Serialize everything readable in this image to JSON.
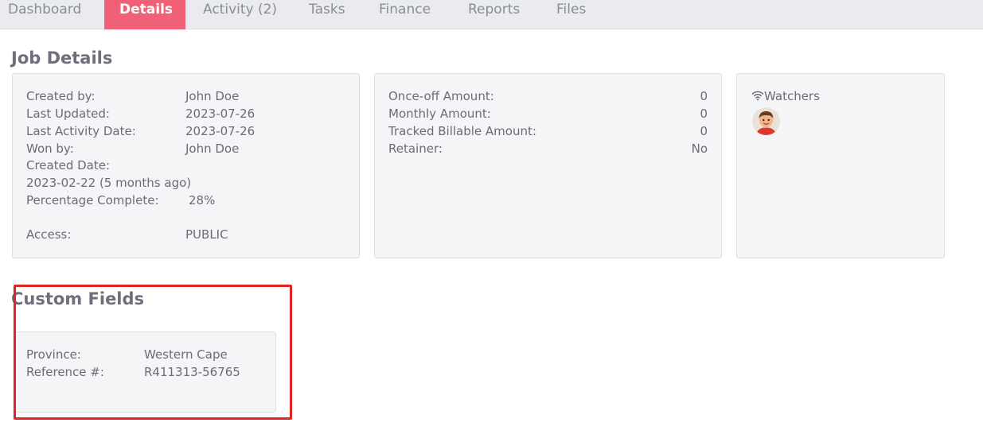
{
  "tabs": {
    "dashboard": "Dashboard",
    "details": "Details",
    "activity": "Activity (2)",
    "tasks": "Tasks",
    "finance": "Finance",
    "reports": "Reports",
    "files": "Files"
  },
  "job_details": {
    "title": "Job Details",
    "info": {
      "created_by_label": "Created by:",
      "created_by_value": "John Doe",
      "last_updated_label": "Last Updated:",
      "last_updated_value": "2023-07-26",
      "last_activity_label": "Last Activity Date:",
      "last_activity_value": "2023-07-26",
      "won_by_label": "Won by:",
      "won_by_value": "John Doe",
      "created_date_label": "Created Date:",
      "created_date_value": "2023-02-22 (5 months ago)",
      "percentage_label": "Percentage Complete:",
      "percentage_value": "28%",
      "access_label": "Access:",
      "access_value": "PUBLIC"
    },
    "amounts": {
      "onceoff_label": "Once-off Amount:",
      "onceoff_value": "0",
      "monthly_label": "Monthly Amount:",
      "monthly_value": "0",
      "tracked_label": "Tracked Billable Amount:",
      "tracked_value": "0",
      "retainer_label": "Retainer:",
      "retainer_value": "No"
    },
    "watchers": {
      "label": "Watchers",
      "icon": "wifi-icon"
    }
  },
  "custom_fields": {
    "title": "Custom Fields",
    "province_label": "Province:",
    "province_value": "Western Cape",
    "reference_label": "Reference #:",
    "reference_value": "R411313-56765"
  },
  "colors": {
    "active_tab": "#f06178",
    "tabbar_bg": "#e9ebee",
    "card_bg": "#f4f5f7",
    "highlight": "#e02424"
  }
}
